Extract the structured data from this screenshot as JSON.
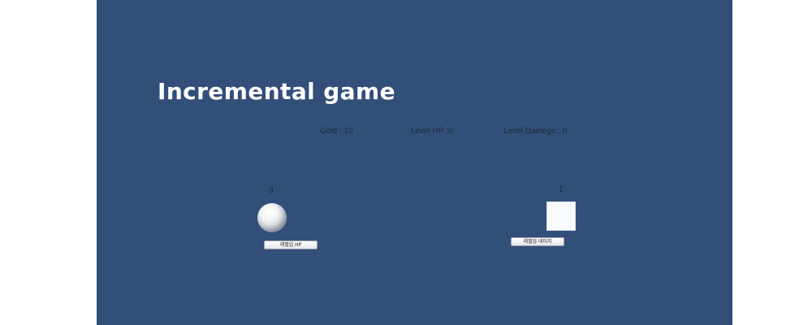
{
  "title": "Incremental game",
  "stats": {
    "gold": "Gold : 10",
    "level_hp": "Level HP :0",
    "level_damage": "Level Damege : 0"
  },
  "left_unit": {
    "count": "3",
    "button_label": "레벨업 HP",
    "shape": "sphere"
  },
  "right_unit": {
    "count": "1",
    "button_label": "레벨업 데미지",
    "shape": "cube"
  },
  "colors": {
    "background": "#324f7a",
    "title": "#ffffff",
    "label_text": "#1f2a38"
  }
}
